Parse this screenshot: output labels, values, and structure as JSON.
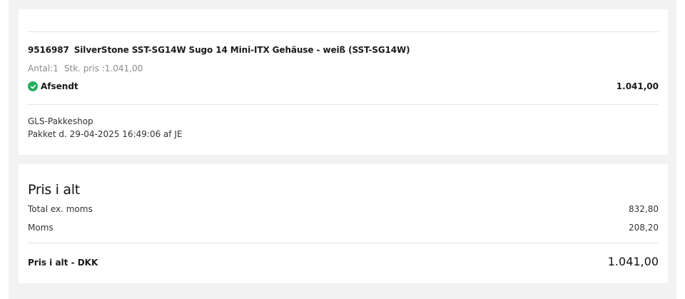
{
  "order_item": {
    "sku": "9516987",
    "name": "SilverStone SST-SG14W Sugo 14 Mini-ITX Gehäuse - weiß (SST-SG14W)",
    "quantity_text": "Antal:1",
    "unit_price_text": "Stk. pris :1.041,00",
    "status": "Afsendt",
    "status_icon": "check-circle-icon",
    "status_color": "#27ae60",
    "line_price": "1.041,00"
  },
  "shipment": {
    "method": "GLS-Pakkeshop",
    "info": "Pakket d. 29-04-2025 16:49:06 af JE"
  },
  "totals": {
    "heading": "Pris i alt",
    "rows": [
      {
        "label": "Total ex. moms",
        "value": "832,80"
      },
      {
        "label": "Moms",
        "value": "208,20"
      }
    ],
    "grand_label": "Pris i alt - DKK",
    "grand_value": "1.041,00"
  }
}
